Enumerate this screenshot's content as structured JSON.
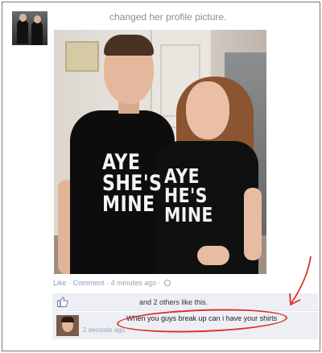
{
  "post": {
    "headline": "changed her profile picture.",
    "shirt_boy": "AYE\nSHE'S\nMINE",
    "shirt_girl": "AYE\nHE'S\nMINE"
  },
  "actions": {
    "like_label": "Like",
    "separator": "·",
    "comment_label": "Comment",
    "timestamp": "4 minutes ago",
    "separator2": "·"
  },
  "likes": {
    "text": "and 2 others like this."
  },
  "comment": {
    "text": "When you guys break up can i have your shirts",
    "time": "2 seconds ago"
  },
  "colors": {
    "annotation": "#d9352a",
    "link": "#8b9bc2",
    "panel_bg": "#edeff4"
  },
  "icons": [
    "globe-icon",
    "thumbs-up-icon",
    "arrow-icon"
  ]
}
